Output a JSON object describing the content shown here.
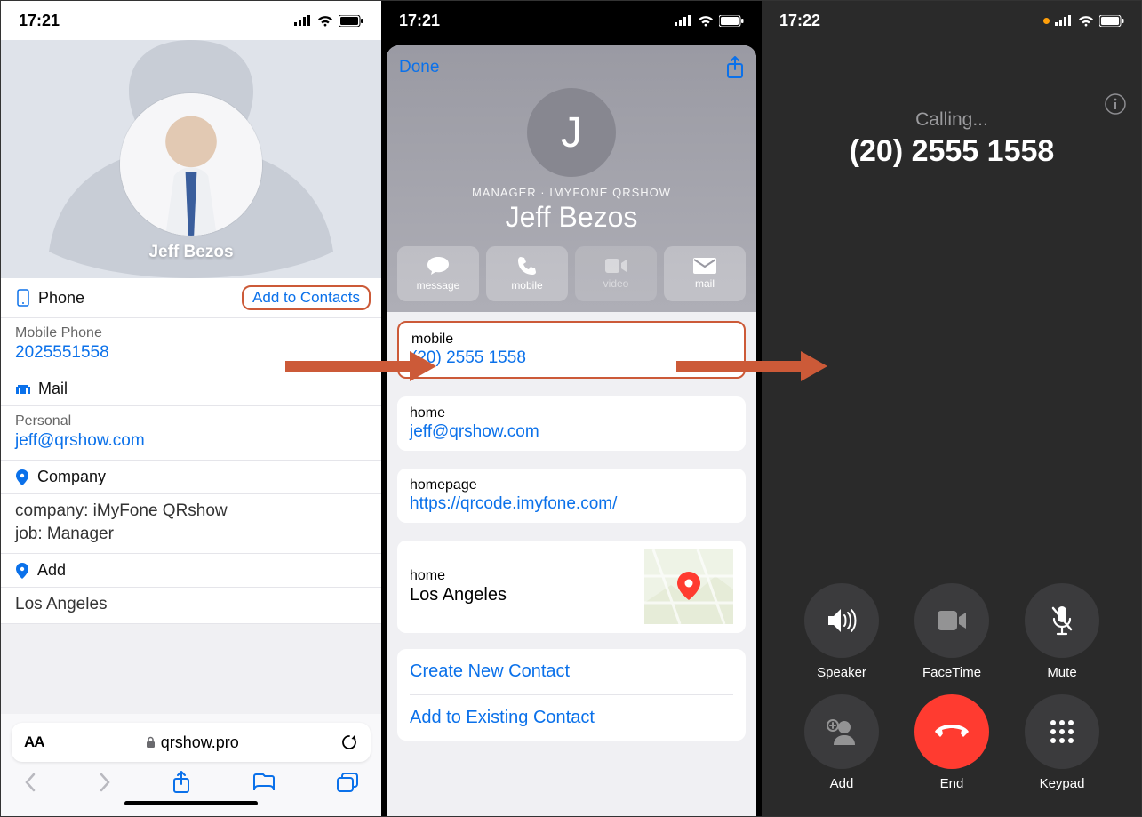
{
  "status": {
    "p1_time": "17:21",
    "p2_time": "17:21",
    "p3_time": "17:22"
  },
  "p1": {
    "name": "Jeff Bezos",
    "phone_section": "Phone",
    "add_contacts": "Add to Contacts",
    "mobile_label": "Mobile Phone",
    "mobile_value": "2025551558",
    "mail_section": "Mail",
    "mail_label": "Personal",
    "mail_value": "jeff@qrshow.com",
    "company_section": "Company",
    "company_line": "company: iMyFone QRshow",
    "job_line": "job: Manager",
    "add_section": "Add",
    "address": "Los Angeles",
    "aa": "AA",
    "url": "qrshow.pro"
  },
  "p2": {
    "done": "Done",
    "initial": "J",
    "subline": "MANAGER · IMYFONE QRSHOW",
    "name": "Jeff Bezos",
    "actions": {
      "message": "message",
      "mobile": "mobile",
      "video": "video",
      "mail": "mail"
    },
    "mobile_label": "mobile",
    "mobile_value": "(20) 2555 1558",
    "home_label": "home",
    "home_value": "jeff@qrshow.com",
    "homepage_label": "homepage",
    "homepage_value": "https://qrcode.imyfone.com/",
    "addr_label": "home",
    "addr_value": "Los Angeles",
    "create": "Create New Contact",
    "existing": "Add to Existing Contact"
  },
  "p3": {
    "calling": "Calling...",
    "number": "(20) 2555 1558",
    "speaker": "Speaker",
    "facetime": "FaceTime",
    "mute": "Mute",
    "add": "Add",
    "end": "End",
    "keypad": "Keypad"
  }
}
